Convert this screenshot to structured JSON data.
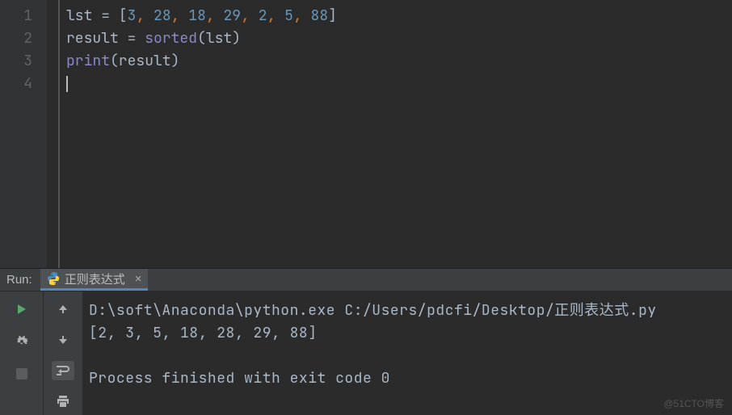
{
  "editor": {
    "line_numbers": [
      "1",
      "2",
      "3",
      "4"
    ],
    "code_tokens": [
      [
        {
          "t": "lst ",
          "c": "tok-var"
        },
        {
          "t": "= ",
          "c": "tok-op"
        },
        {
          "t": "[",
          "c": "tok-punct"
        },
        {
          "t": "3",
          "c": "tok-num"
        },
        {
          "t": ", ",
          "c": "tok-comma"
        },
        {
          "t": "28",
          "c": "tok-num"
        },
        {
          "t": ", ",
          "c": "tok-comma"
        },
        {
          "t": "18",
          "c": "tok-num"
        },
        {
          "t": ", ",
          "c": "tok-comma"
        },
        {
          "t": "29",
          "c": "tok-num"
        },
        {
          "t": ", ",
          "c": "tok-comma"
        },
        {
          "t": "2",
          "c": "tok-num"
        },
        {
          "t": ", ",
          "c": "tok-comma"
        },
        {
          "t": "5",
          "c": "tok-num"
        },
        {
          "t": ", ",
          "c": "tok-comma"
        },
        {
          "t": "88",
          "c": "tok-num"
        },
        {
          "t": "]",
          "c": "tok-punct"
        }
      ],
      [
        {
          "t": "result ",
          "c": "tok-var"
        },
        {
          "t": "= ",
          "c": "tok-op"
        },
        {
          "t": "sorted",
          "c": "tok-builtin"
        },
        {
          "t": "(lst)",
          "c": "tok-punct"
        }
      ],
      [
        {
          "t": "print",
          "c": "tok-builtin2"
        },
        {
          "t": "(result)",
          "c": "tok-punct"
        }
      ],
      []
    ]
  },
  "run": {
    "label": "Run:",
    "tab_name": "正则表达式",
    "console_lines": [
      "D:\\soft\\Anaconda\\python.exe C:/Users/pdcfi/Desktop/正则表达式.py",
      "[2, 3, 5, 18, 28, 29, 88]",
      "",
      "Process finished with exit code 0"
    ]
  },
  "watermark": "@51CTO博客"
}
